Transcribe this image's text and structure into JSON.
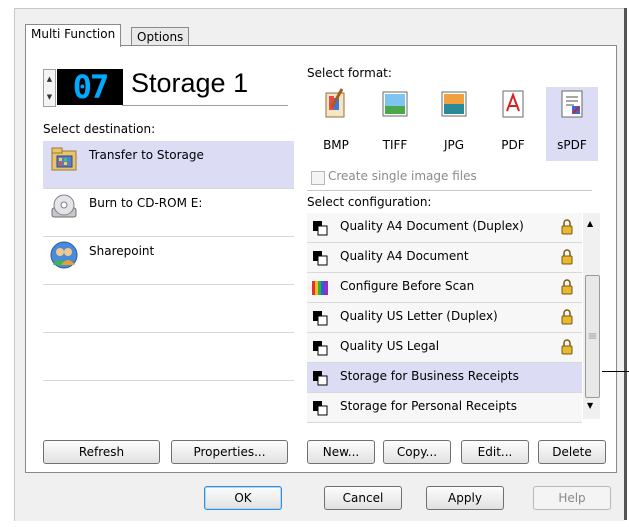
{
  "tabs": {
    "multi_function": "Multi Function",
    "options": "Options"
  },
  "profile": {
    "number": "07",
    "name": "Storage 1"
  },
  "destination": {
    "label": "Select destination:",
    "items": [
      {
        "label": "Transfer to Storage",
        "icon": "storage-folder-icon"
      },
      {
        "label": "Burn to CD-ROM  E:",
        "icon": "cd-rom-icon"
      },
      {
        "label": "Sharepoint",
        "icon": "sharepoint-icon"
      }
    ],
    "refresh_label": "Refresh",
    "properties_label": "Properties..."
  },
  "format": {
    "label": "Select format:",
    "items": [
      {
        "label": "BMP"
      },
      {
        "label": "TIFF"
      },
      {
        "label": "JPG"
      },
      {
        "label": "PDF"
      },
      {
        "label": "sPDF"
      }
    ],
    "single_image_label": "Create single image files"
  },
  "configuration": {
    "label": "Select configuration:",
    "items": [
      {
        "label": "Quality A4 Document (Duplex)",
        "locked": true
      },
      {
        "label": "Quality A4 Document",
        "locked": true
      },
      {
        "label": "Configure Before Scan",
        "locked": true
      },
      {
        "label": "Quality US Letter (Duplex)",
        "locked": true
      },
      {
        "label": "Quality US Legal",
        "locked": true
      },
      {
        "label": "Storage for Business Receipts",
        "locked": false
      },
      {
        "label": "Storage for Personal Receipts",
        "locked": false
      }
    ],
    "new_label": "New...",
    "copy_label": "Copy...",
    "edit_label": "Edit...",
    "delete_label": "Delete"
  },
  "dialog": {
    "ok": "OK",
    "cancel": "Cancel",
    "apply": "Apply",
    "help": "Help"
  },
  "colors": {
    "selection": "#dcdcf5",
    "lcd_digits": "#00aaff",
    "lock": "#e8b830"
  }
}
